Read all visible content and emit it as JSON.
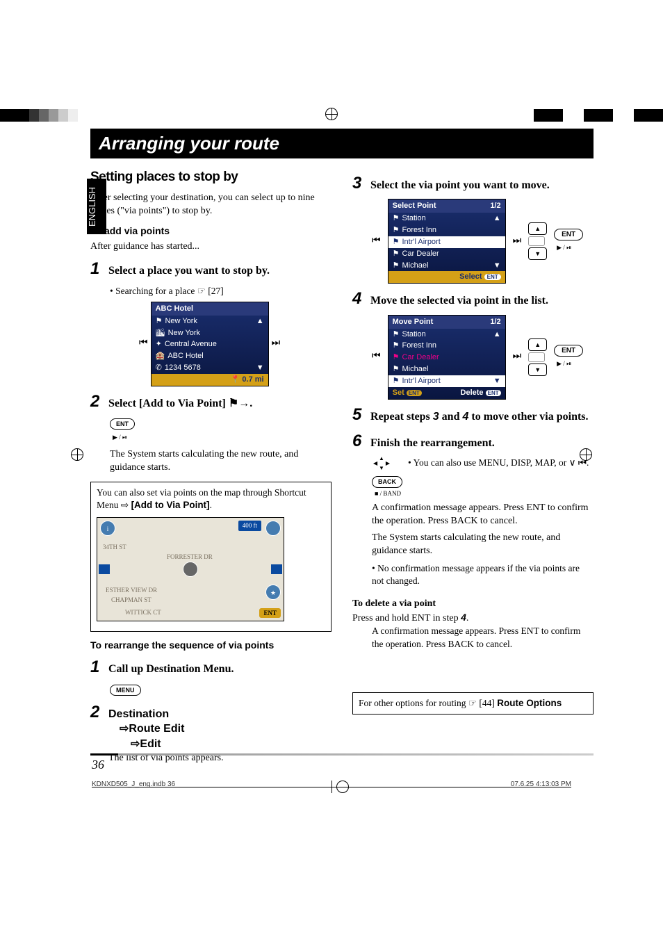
{
  "page": {
    "language_tab": "ENGLISH",
    "title": "Arranging your route",
    "page_number": "36",
    "footer_left": "KDNXD505_J_eng.indb   36",
    "footer_right": "07.6.25   4:13:03 PM"
  },
  "left": {
    "section_title": "Setting places to stop by",
    "intro": "After selecting your destination, you can select up to nine places (\"via points\") to stop by.",
    "sub1": "To add via points",
    "sub1_after": "After guidance has started...",
    "step1": "Select a place you want to stop by.",
    "step1_bullet": "Searching for a place ☞ [27]",
    "step2": "Select [Add to Via Point]",
    "ent_label": "ENT",
    "ent_sub": "▶ / ⏯",
    "step2_para": "The System starts calculating the new route, and guidance starts.",
    "box_text_pre": "You can also set via points on the map through Shortcut Menu ⇨ ",
    "box_text_bold": "[Add to Via Point]",
    "sub2": "To rearrange the sequence of via points",
    "step_b1": "Call up Destination Menu.",
    "menu_label": "MENU",
    "menu_path_1": "Destination",
    "menu_path_2": "⇨Route Edit",
    "menu_path_3": "⇨Edit",
    "step_b2_after": "The list of via points appears."
  },
  "hotel_screen": {
    "title": "ABC Hotel",
    "rows": [
      "New York",
      "New York",
      "Central Avenue",
      "ABC Hotel",
      "1234 5678"
    ],
    "dist": "0.7 mi"
  },
  "map": {
    "badge": "400 ft",
    "street1": "34TH ST",
    "street2": "FORRESTER DR",
    "street3": "ESTHER VIEW DR",
    "street4": "CHAPMAN ST",
    "street5": "WITTICK CT",
    "ent": "ENT"
  },
  "right": {
    "step3": "Select the via point you want to move.",
    "step4": "Move the selected via point in the list.",
    "step5_pre": "Repeat steps ",
    "step5_ref1": "3",
    "step5_mid": " and ",
    "step5_ref2": "4",
    "step5_post": " to move other via points.",
    "step6": "Finish the rearrangement.",
    "step6_bullet": "You can also use MENU, DISP, MAP, or ∨ ⏮.",
    "back_label": "BACK",
    "back_sub": "■ / BAND",
    "para1": "A confirmation message appears. Press ENT to confirm the operation. Press BACK to cancel.",
    "para2": "The System starts calculating the new route, and guidance starts.",
    "bullet2": "No confirmation message appears if the via points are not changed.",
    "delete_title": "To delete a via point",
    "delete_line_pre": "Press and hold ENT in step ",
    "delete_line_ref": "4",
    "delete_para": "A confirmation message appears. Press ENT to confirm the operation. Press BACK to cancel.",
    "footer_box_pre": "For other options for routing ☞ [44] ",
    "footer_box_bold": "Route Options"
  },
  "select_screen": {
    "title": "Select Point",
    "page": "1/2",
    "rows": [
      "Station",
      "Forest Inn",
      "Intr'l Airport",
      "Car Dealer",
      "Michael"
    ],
    "footer": "Select",
    "ent": "ENT"
  },
  "move_screen": {
    "title": "Move Point",
    "page": "1/2",
    "rows": [
      "Station",
      "Forest Inn",
      "Car Dealer",
      "Michael",
      "Intr'l Airport"
    ],
    "set": "Set",
    "delete": "Delete",
    "ent": "ENT"
  },
  "ctrl": {
    "ent": "ENT",
    "sub": "▶ / ⏯"
  }
}
